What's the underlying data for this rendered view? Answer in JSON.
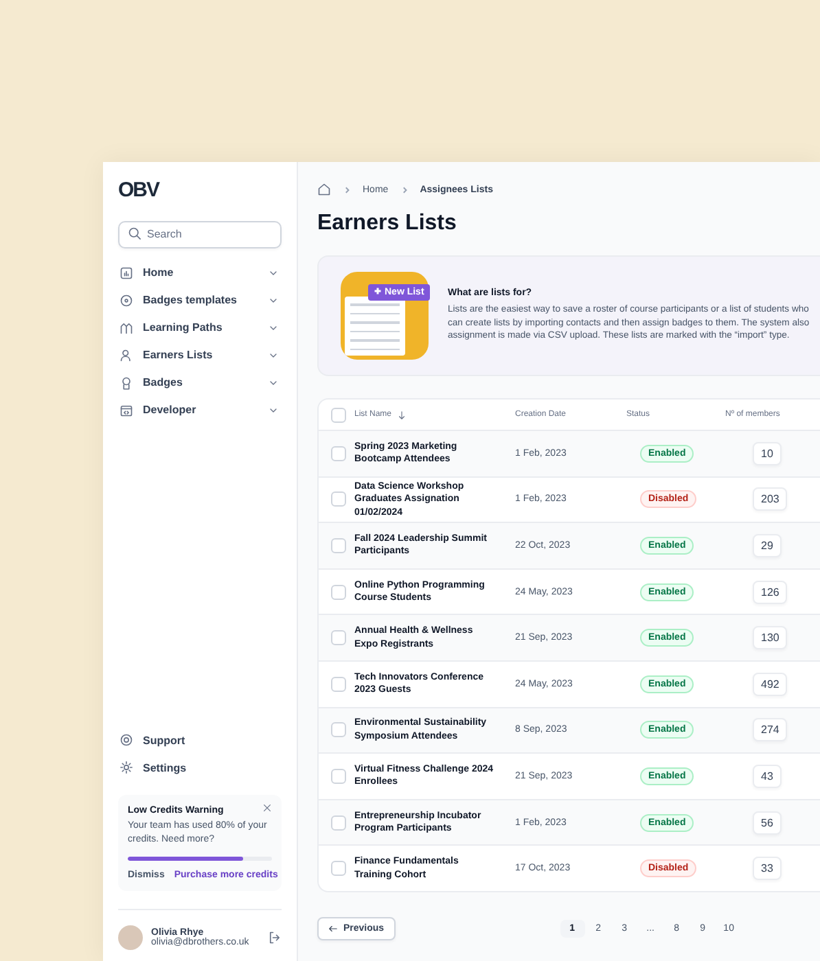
{
  "sidebar": {
    "logo": "OBV",
    "search": {
      "placeholder": "Search"
    },
    "nav_items": [
      {
        "label": "Home"
      },
      {
        "label": "Badges templates"
      },
      {
        "label": "Learning Paths"
      },
      {
        "label": "Earners Lists"
      },
      {
        "label": "Badges"
      },
      {
        "label": "Developer"
      }
    ],
    "footer_items": [
      {
        "label": "Support"
      },
      {
        "label": "Settings"
      }
    ],
    "credits_card": {
      "title": "Low Credits Warning",
      "text": "Your team has used 80% of your credits. Need more?",
      "level": 0.8,
      "dismiss": "Dismiss",
      "purchase": "Purchase more credits"
    },
    "user": {
      "name": "Olivia Rhye",
      "email": "olivia@dbrothers.co.uk"
    }
  },
  "breadcrumb": [
    "Home",
    "Assignees Lists"
  ],
  "title": "Earners Lists",
  "info_banner": {
    "illustration_button": "New List",
    "heading": "What are lists for?",
    "lines": [
      "Lists are the easiest way to save a roster of course participants or a list of students who",
      "can create lists by importing contacts and then assign badges to them. The system also",
      "assignment is made via CSV upload. These lists are marked with the “import” type."
    ]
  },
  "table": {
    "columns": [
      "List Name",
      "Creation Date",
      "Status",
      "Nº of members"
    ],
    "header_checked": false,
    "rows": [
      {
        "name": "Spring 2023 Marketing Bootcamp Attendees",
        "date": "1 Feb, 2023",
        "status": "Enabled",
        "enabled": true,
        "members": "10",
        "checked": false
      },
      {
        "name": "Data Science Workshop Graduates Assignation 01/02/2024",
        "date": "1 Feb, 2023",
        "status": "Disabled",
        "enabled": false,
        "members": "203",
        "checked": false
      },
      {
        "name": "Fall 2024 Leadership Summit Participants",
        "date": "22 Oct, 2023",
        "status": "Enabled",
        "enabled": true,
        "members": "29",
        "checked": false
      },
      {
        "name": "Online Python Programming Course Students",
        "date": "24 May, 2023",
        "status": "Enabled",
        "enabled": true,
        "members": "126",
        "checked": false
      },
      {
        "name": "Annual Health & Wellness Expo Registrants",
        "date": "21 Sep, 2023",
        "status": "Enabled",
        "enabled": true,
        "members": "130",
        "checked": false
      },
      {
        "name": "Tech Innovators Conference 2023 Guests",
        "date": "24 May, 2023",
        "status": "Enabled",
        "enabled": true,
        "members": "492",
        "checked": false
      },
      {
        "name": "Environmental Sustainability Symposium Attendees",
        "date": "8 Sep, 2023",
        "status": "Enabled",
        "enabled": true,
        "members": "274",
        "checked": false
      },
      {
        "name": "Virtual Fitness Challenge 2024 Enrollees",
        "date": "21 Sep, 2023",
        "status": "Enabled",
        "enabled": true,
        "members": "43",
        "checked": false
      },
      {
        "name": "Entrepreneurship Incubator Program Participants",
        "date": "1 Feb, 2023",
        "status": "Enabled",
        "enabled": true,
        "members": "56",
        "checked": false
      },
      {
        "name": "Finance Fundamentals Training Cohort",
        "date": "17 Oct, 2023",
        "status": "Disabled",
        "enabled": false,
        "members": "33",
        "checked": false
      }
    ]
  },
  "pagination": {
    "previous": "Previous",
    "pages": [
      {
        "label": "1",
        "selected": true
      },
      {
        "label": "2",
        "selected": false
      },
      {
        "label": "3",
        "selected": false
      },
      {
        "label": "...",
        "selected": false
      },
      {
        "label": "8",
        "selected": false
      },
      {
        "label": "9",
        "selected": false
      },
      {
        "label": "10",
        "selected": false
      }
    ]
  }
}
